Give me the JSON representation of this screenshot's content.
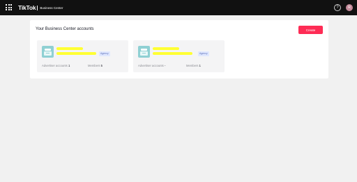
{
  "topbar": {
    "brand": "TikTok",
    "product": "Business Center",
    "help_symbol": "?",
    "avatar_initial": "R",
    "icons": [
      "apps-grid-icon",
      "help-icon"
    ]
  },
  "panel": {
    "title": "Your Business Center accounts",
    "create_label": "Create"
  },
  "accounts": [
    {
      "tag": "Agency",
      "ad_accounts_label": "Advertiser accounts",
      "ad_accounts_value": "1",
      "members_label": "Members",
      "members_value": "5",
      "icon": "business-center-icon"
    },
    {
      "tag": "Agency",
      "ad_accounts_label": "Advertiser accounts",
      "ad_accounts_value": "-",
      "members_label": "Members",
      "members_value": "1",
      "icon": "business-center-icon"
    }
  ],
  "colors": {
    "topbar_bg": "#111111",
    "page_bg": "#f1f1f1",
    "accent": "#fe2c55",
    "card_bg": "#f4f4f5",
    "icon_bg": "#8fd0d3",
    "redaction": "#ffff33",
    "tag_bg": "#dfe7ff"
  }
}
